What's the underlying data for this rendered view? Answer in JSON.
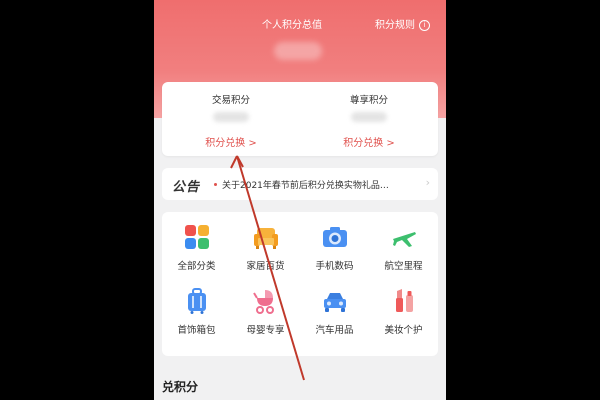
{
  "header": {
    "title": "个人积分总值",
    "rule_label": "积分规则",
    "info_icon": "i"
  },
  "points": {
    "left": {
      "label": "交易积分",
      "link": "积分兑换 >"
    },
    "right": {
      "label": "尊享积分",
      "link": "积分兑换 >"
    }
  },
  "notice": {
    "tag": "公告",
    "text": "关于2021年春节前后积分兑换实物礼品…",
    "arrow": "›"
  },
  "categories": [
    {
      "label": "全部分类",
      "icon": "grid-icon"
    },
    {
      "label": "家居百货",
      "icon": "sofa-icon"
    },
    {
      "label": "手机数码",
      "icon": "camera-icon"
    },
    {
      "label": "航空里程",
      "icon": "airplane-icon"
    },
    {
      "label": "首饰箱包",
      "icon": "luggage-icon"
    },
    {
      "label": "母婴专享",
      "icon": "stroller-icon"
    },
    {
      "label": "汽车用品",
      "icon": "car-icon"
    },
    {
      "label": "美妆个护",
      "icon": "cosmetics-icon"
    }
  ],
  "section": {
    "title": "兑积分"
  },
  "colors": {
    "brand": "#ef6e6e",
    "link": "#e0524e",
    "annotation": "#c0392b"
  }
}
